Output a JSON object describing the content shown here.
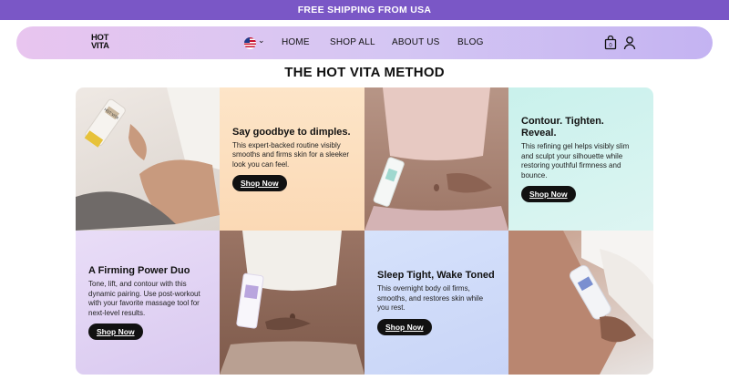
{
  "announcement": {
    "text": "FREE SHIPPING FROM USA"
  },
  "header": {
    "logo_line1": "HOT",
    "logo_line2": "VITA",
    "country_icon": "us-flag-icon",
    "menu": [
      {
        "label": "HOME"
      },
      {
        "label": "SHOP ALL"
      },
      {
        "label": "ABOUT US"
      },
      {
        "label": "BLOG"
      }
    ],
    "icons": [
      "shopping-bag-icon",
      "user-icon"
    ]
  },
  "section": {
    "title": "THE HOT VITA METHOD",
    "tiles": [
      {
        "title": "Say goodbye to dimples.",
        "body": "This expert-backed routine visibly smooths and firms skin for a sleeker look you can feel.",
        "button": "Shop Now",
        "color": "#fde5c8"
      },
      {
        "title": "Contour. Tighten. Reveal.",
        "body": "This refining gel helps visibly slim and sculpt your silhouette while restoring youthful firmness and bounce.",
        "button": "Shop Now",
        "color": "#c9f1ec"
      },
      {
        "title": "A Firming Power Duo",
        "body": "Tone, lift, and contour with this dynamic pairing. Use post-workout with your favorite massage tool for next-level results.",
        "button": "Shop Now",
        "color": "#e9ddf7"
      },
      {
        "title": "Sleep Tight, Wake Toned",
        "body": "This overnight body oil firms, smooths, and restores skin while you rest.",
        "button": "Shop Now",
        "color": "#d6e2fb"
      }
    ],
    "product_label": "HOT VITA"
  },
  "colors": {
    "announcement_bg": "#7a57c6",
    "button_bg": "#111111"
  }
}
